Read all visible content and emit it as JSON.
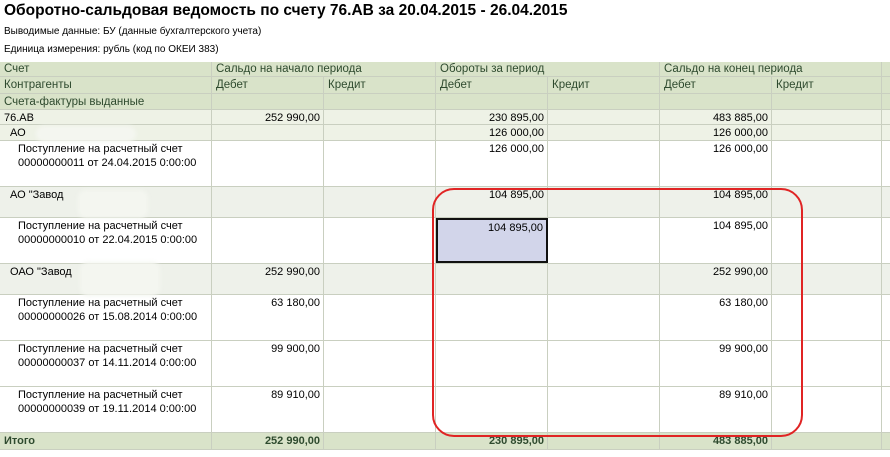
{
  "report": {
    "title": "Оборотно-сальдовая ведомость по счету 76.АВ за 20.04.2015 - 26.04.2015",
    "params": [
      "Выводимые данные:  БУ (данные бухгалтерского учета)",
      "Единица измерения:  рубль (код по ОКЕИ 383)"
    ]
  },
  "columns": {
    "account": "Счет",
    "counterparties": "Контрагенты",
    "invoices": "Счета-фактуры выданные",
    "opening": "Сальдо на начало периода",
    "turnover": "Обороты за период",
    "closing": "Сальдо на конец периода",
    "debit": "Дебет",
    "credit": "Кредит"
  },
  "rows": [
    {
      "label": "76.АВ",
      "open_debit": "252 990,00",
      "open_credit": "",
      "turn_debit": "230 895,00",
      "turn_credit": "",
      "close_debit": "483 885,00",
      "close_credit": ""
    },
    {
      "label": "АО",
      "open_debit": "",
      "open_credit": "",
      "turn_debit": "126 000,00",
      "turn_credit": "",
      "close_debit": "126 000,00",
      "close_credit": ""
    },
    {
      "label": "Поступление на расчетный счет 00000000011 от 24.04.2015 0:00:00",
      "open_debit": "",
      "open_credit": "",
      "turn_debit": "126 000,00",
      "turn_credit": "",
      "close_debit": "126 000,00",
      "close_credit": ""
    },
    {
      "label": "АО \"Завод",
      "open_debit": "",
      "open_credit": "",
      "turn_debit": "104 895,00",
      "turn_credit": "",
      "close_debit": "104 895,00",
      "close_credit": ""
    },
    {
      "label": "Поступление на расчетный счет 00000000010 от 22.04.2015 0:00:00",
      "open_debit": "",
      "open_credit": "",
      "turn_debit": "104 895,00",
      "turn_credit": "",
      "close_debit": "104 895,00",
      "close_credit": ""
    },
    {
      "label": "ОАО \"Завод",
      "open_debit": "252 990,00",
      "open_credit": "",
      "turn_debit": "",
      "turn_credit": "",
      "close_debit": "252 990,00",
      "close_credit": ""
    },
    {
      "label": "Поступление на расчетный счет 00000000026 от 15.08.2014 0:00:00",
      "open_debit": "63 180,00",
      "open_credit": "",
      "turn_debit": "",
      "turn_credit": "",
      "close_debit": "63 180,00",
      "close_credit": ""
    },
    {
      "label": "Поступление на расчетный счет 00000000037 от 14.11.2014 0:00:00",
      "open_debit": "99 900,00",
      "open_credit": "",
      "turn_debit": "",
      "turn_credit": "",
      "close_debit": "99 900,00",
      "close_credit": ""
    },
    {
      "label": "Поступление на расчетный счет 00000000039 от 19.11.2014 0:00:00",
      "open_debit": "89 910,00",
      "open_credit": "",
      "turn_debit": "",
      "turn_credit": "",
      "close_debit": "89 910,00",
      "close_credit": ""
    }
  ],
  "total": {
    "label": "Итого",
    "open_debit": "252 990,00",
    "open_credit": "",
    "turn_debit": "230 895,00",
    "turn_credit": "",
    "close_debit": "483 885,00",
    "close_credit": ""
  },
  "colors": {
    "header_bg": "#d9e3c9",
    "group_bg": "#eef2e6",
    "selection_bg": "#d2d5ea",
    "annotation": "#e02424"
  }
}
